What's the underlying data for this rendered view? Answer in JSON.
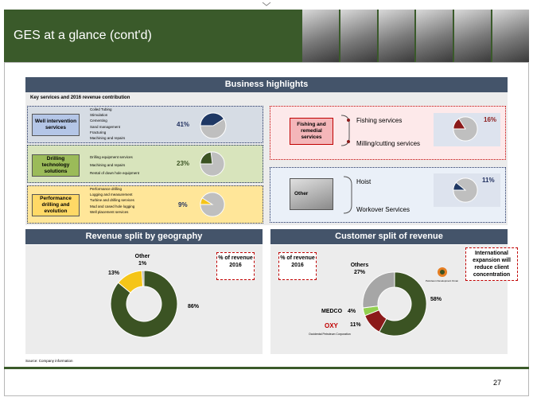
{
  "header": {
    "title": "GES at a glance (cont'd)"
  },
  "business": {
    "bar_title": "Business highlights",
    "subheading": "Key services and 2016 revenue contribution",
    "well": {
      "label": "Well intervention services",
      "pct": "41%",
      "value": 41,
      "items": [
        "Coiled Tubing",
        "Stimulation",
        "Cementing",
        "Sand management",
        "Fracturing",
        "Machining and repairs"
      ]
    },
    "drilling": {
      "label": "Drilling technology solutions",
      "pct": "23%",
      "value": 23,
      "items": [
        "Drilling equipment services",
        "Machining and repairs",
        "Rental of down hole equipment"
      ]
    },
    "performance": {
      "label": "Performance drilling and evolution",
      "pct": "9%",
      "value": 9,
      "items": [
        "Performance drilling",
        "Logging and measurement",
        "Turbine and drilling services",
        "Mud and cased hole logging",
        "Well placement services"
      ]
    },
    "fishing": {
      "label": "Fishing and remedial services",
      "pct": "16%",
      "value": 16,
      "items": [
        "Fishing  services",
        "Milling/cutting services"
      ]
    },
    "other": {
      "label": "Other",
      "pct": "11%",
      "value": 11,
      "items": [
        "Hoist",
        "Workover Services"
      ]
    }
  },
  "geography": {
    "bar_title": "Revenue split by geography",
    "callout": "% of revenue 2016",
    "segments": [
      {
        "value": 86,
        "label": "86%",
        "color": "#3b5323"
      },
      {
        "value": 13,
        "label": "13%",
        "color": "#f5c518"
      },
      {
        "value": 1,
        "label": "1%",
        "color": "#a6a6a6"
      }
    ],
    "other_label": "Other",
    "other_pct": "1%"
  },
  "customers": {
    "bar_title": "Customer split of revenue",
    "callout": "% of revenue 2016",
    "callout2": "International expansion will reduce client concentration",
    "segments": [
      {
        "value": 58,
        "label": "58%",
        "color": "#3b5323"
      },
      {
        "value": 11,
        "label": "11%",
        "color": "#8b1a1a"
      },
      {
        "value": 4,
        "label": "4%",
        "color": "#92d050"
      },
      {
        "value": 27,
        "label": "27%",
        "color": "#a6a6a6"
      }
    ],
    "others_label": "Others",
    "others_pct": "27%",
    "medco_label": "MEDCO",
    "medco_pct": "4%",
    "oxy_pct": "11%",
    "oxy_logo_text": "OXY",
    "oxy_caption": "Occidental Petroleum Corporation",
    "pdo_caption": "Petroleum Development Oman"
  },
  "footer": {
    "source": "Source:  Company  information",
    "page": "27"
  },
  "colors": {
    "header_green": "#3a5a2a",
    "bar_navy": "#44546a",
    "accent_red": "#c00000",
    "pie_dark": "#1f3864"
  }
}
